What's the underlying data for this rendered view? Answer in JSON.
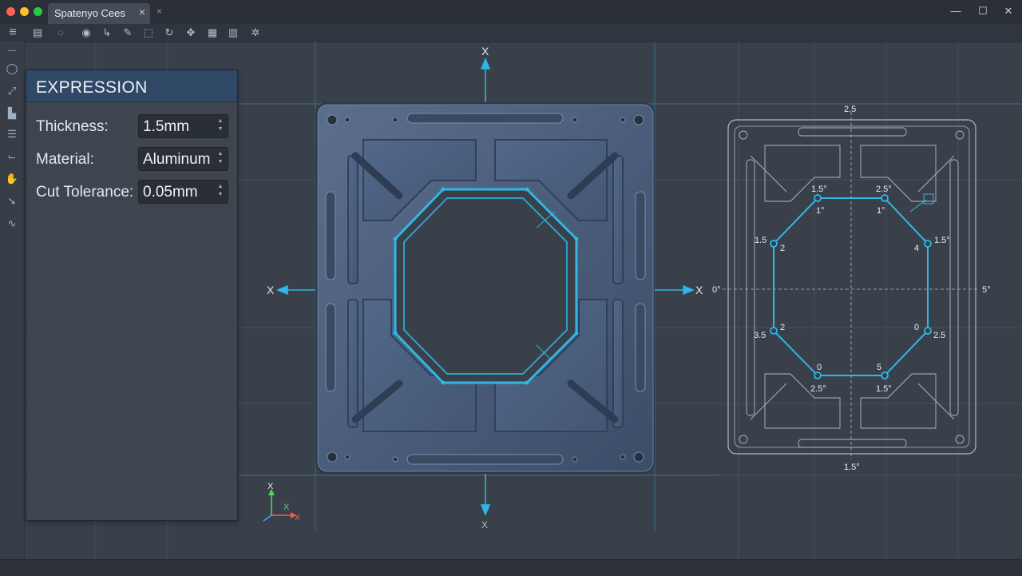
{
  "window": {
    "tab_title": "Spatenyo Cees",
    "tab_close": "×",
    "new_tab": "×",
    "controls": {
      "minimize": "—",
      "maximize": "☐",
      "close": "✕"
    }
  },
  "toolbar": {
    "icons": [
      "menu-icon",
      "layers-icon",
      "orbit-icon",
      "view-icon",
      "move-icon",
      "edit-icon",
      "rotate-icon",
      "brush-icon",
      "transform-icon",
      "table-icon",
      "chart-icon",
      "settings-icon"
    ]
  },
  "side_tools": [
    "line-icon",
    "circle-icon",
    "dimension-icon",
    "copy-icon",
    "align-icon",
    "constraint-icon",
    "hand-icon",
    "select-icon",
    "path-icon"
  ],
  "expression_panel": {
    "title": "EXPRESSION",
    "fields": [
      {
        "label": "Thickness:",
        "value": "1.5mm"
      },
      {
        "label": "Material:",
        "value": "Aluminum"
      },
      {
        "label": "Cut Tolerance:",
        "value": "0.05mm"
      }
    ]
  },
  "viewport": {
    "axis_labels": {
      "top": "X",
      "left": "X",
      "right": "X",
      "bottom": "X"
    },
    "triad": {
      "x": "X",
      "y": "X",
      "z": "X"
    }
  },
  "drawing": {
    "dims": {
      "top": "2.5",
      "bottom": "1.5°",
      "left": "0°",
      "right": "5°",
      "v_tl_out": "1.5°",
      "v_tl_in": "1°",
      "v_tr_out": "2.5°",
      "v_tr_in": "1°",
      "v_rt_out": "1.5°",
      "v_rt_in": "4",
      "v_rb_out": "2.5",
      "v_rb_in": "0",
      "v_br_out": "1.5°",
      "v_br_in": "5",
      "v_bl_out": "2.5°",
      "v_bl_in": "0",
      "v_lb_out": "3.5",
      "v_lb_in": "2",
      "v_lt_out": "1.5",
      "v_lt_in": "2"
    }
  },
  "colors": {
    "accent": "#2fb7e6",
    "panel_header": "#2e4866",
    "background": "#3a4049",
    "part": "#4a5d7a"
  }
}
